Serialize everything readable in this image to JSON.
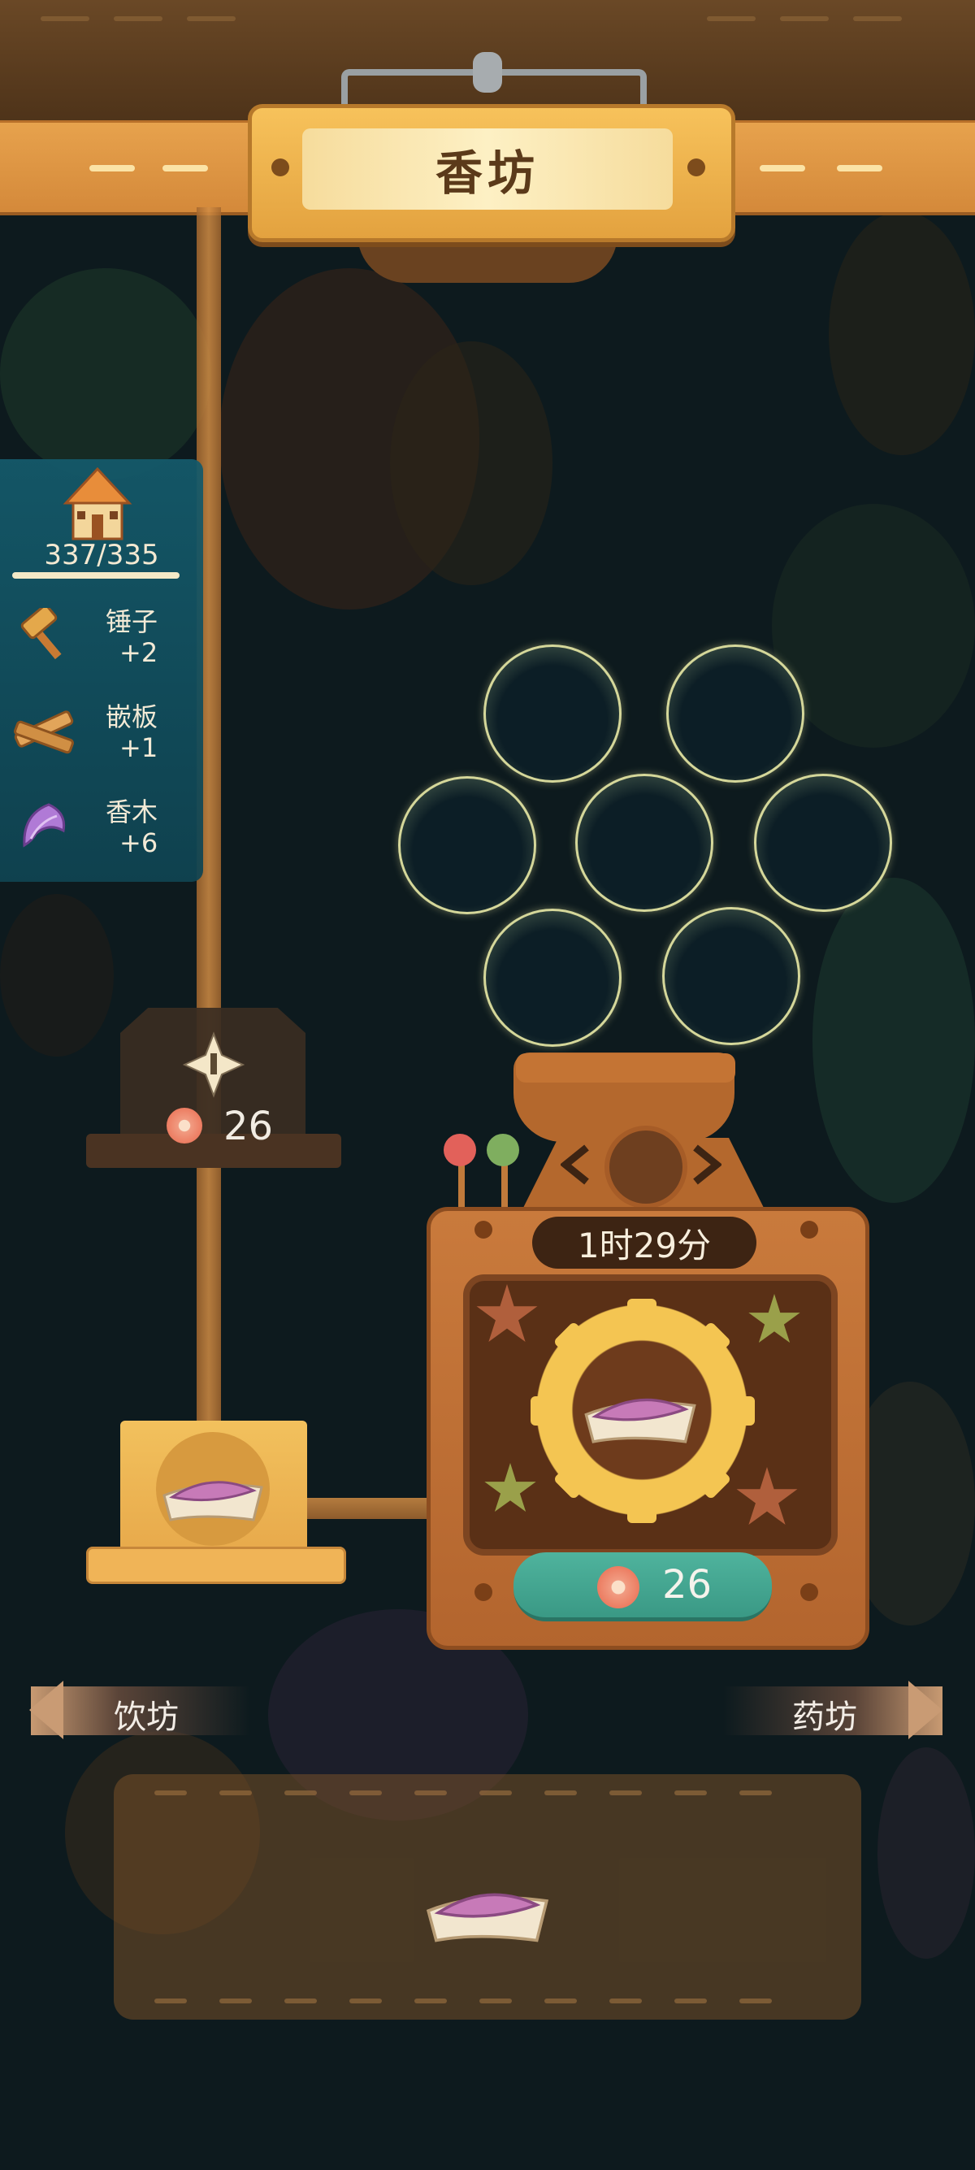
{
  "title": "香坊",
  "stats": {
    "capacity": "337/335",
    "items": [
      {
        "name": "锤子",
        "amount": "+2",
        "icon": "hammer-icon"
      },
      {
        "name": "嵌板",
        "amount": "+1",
        "icon": "plank-icon"
      },
      {
        "name": "香木",
        "amount": "+6",
        "icon": "incense-wood-icon"
      }
    ]
  },
  "upgrade": {
    "cost": "26",
    "icon": "sparkle-icon"
  },
  "machine": {
    "timer": "1时29分",
    "speedup_cost": "26"
  },
  "nav": {
    "prev": "饮坊",
    "next": "药坊"
  },
  "colors": {
    "accent_gold": "#f4c552",
    "button_teal": "#3a9985",
    "panel_blue": "#145a6b"
  }
}
